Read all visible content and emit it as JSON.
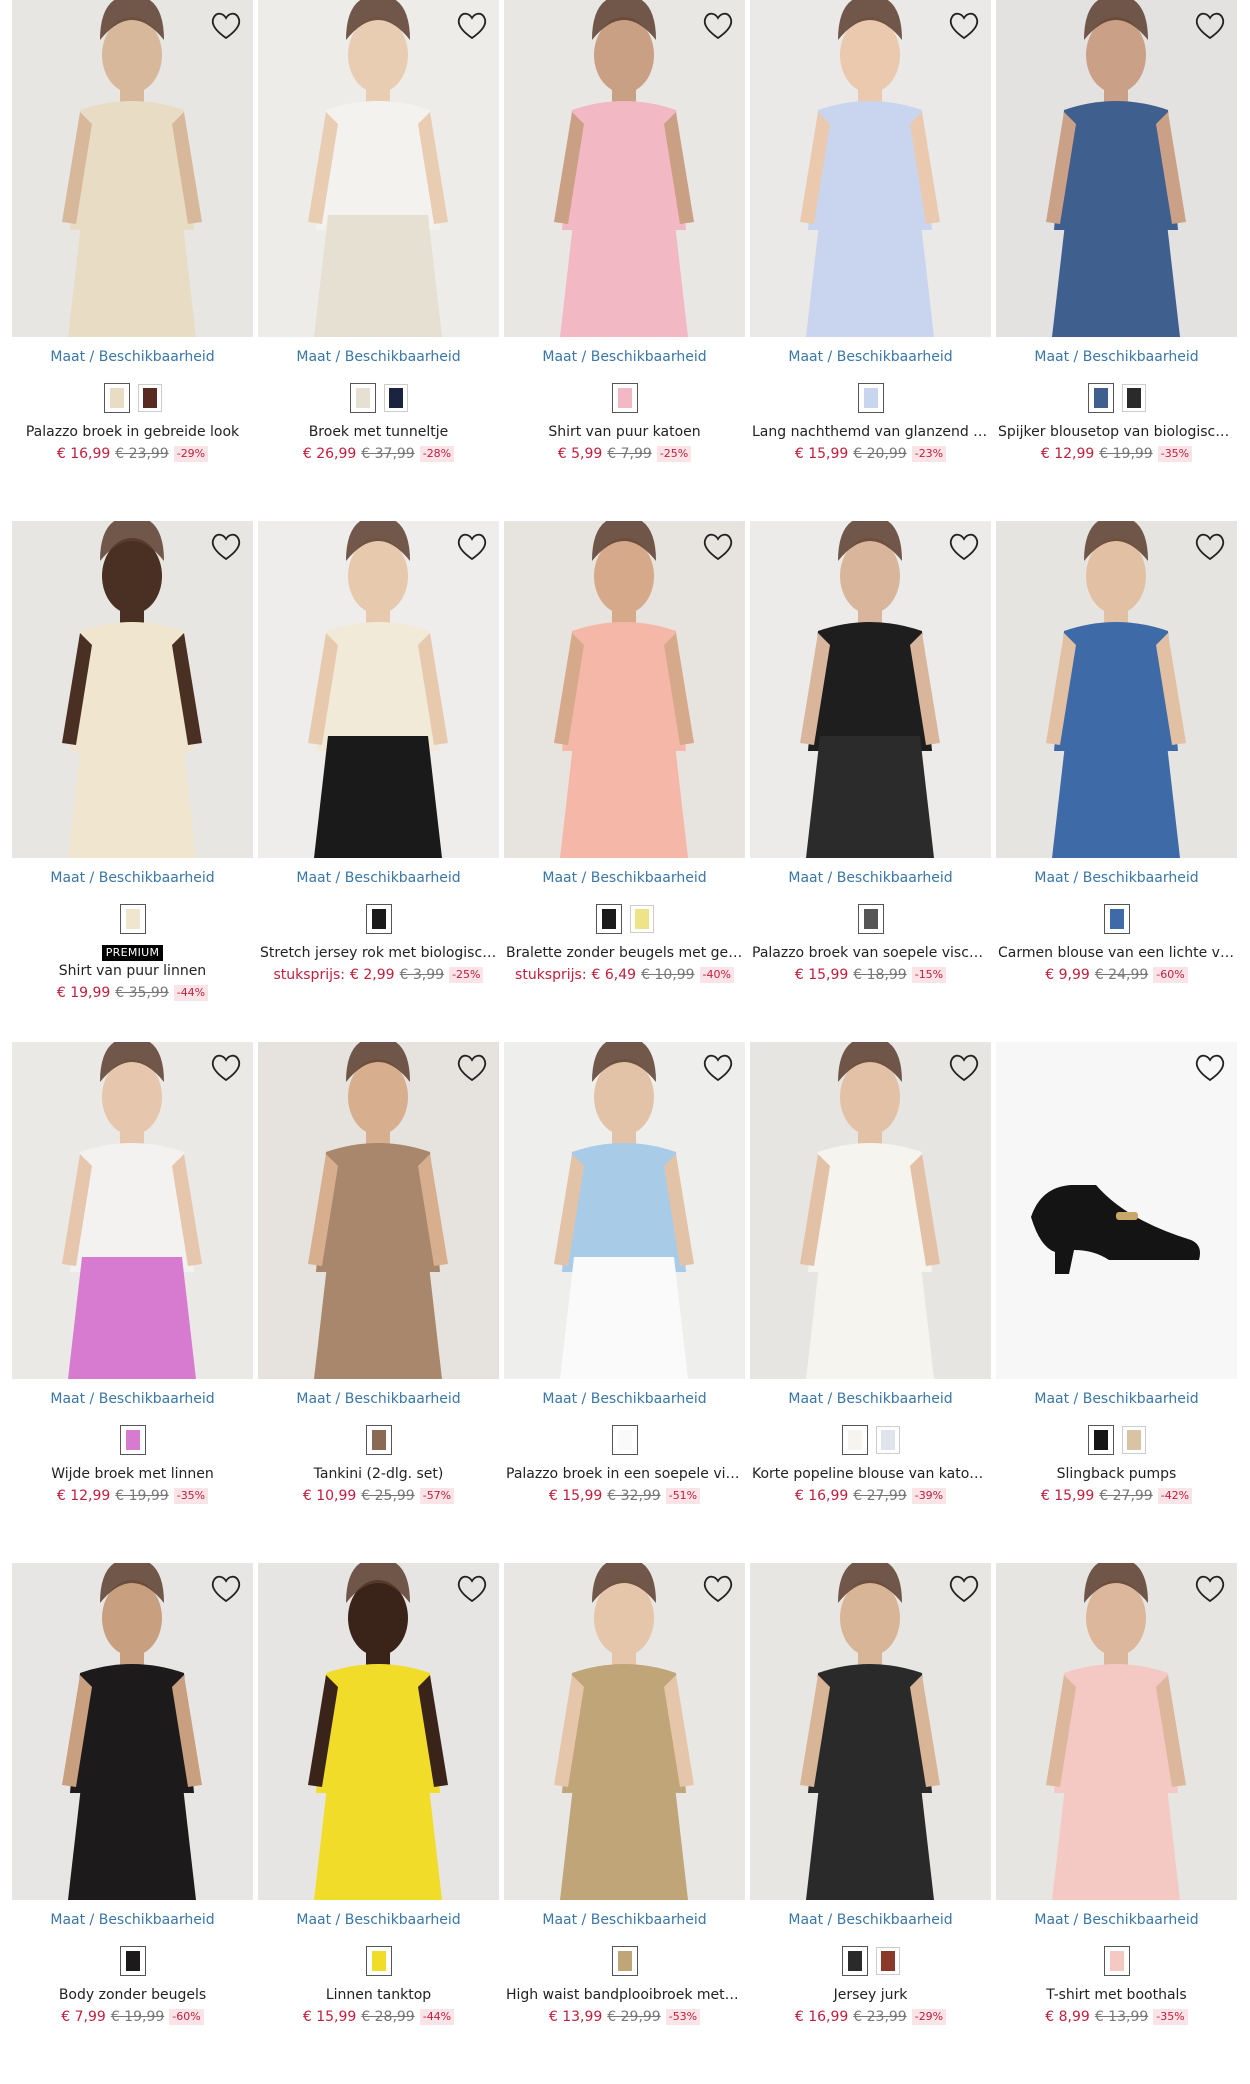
{
  "size_link_label": "Maat / Beschikbaarheid",
  "colors": {
    "price": "#c01e3c",
    "link": "#3a76a6"
  },
  "products": [
    {
      "name": "Palazzo broek in gebreide look",
      "price": "€ 16,99",
      "old": "€ 23,99",
      "discount": "-29%",
      "bg": "#e8e6e3",
      "garment": "#e8dcc4",
      "skin": "#d8b89a",
      "top": "#e8dcc4",
      "swatches": [
        "#e8dcc4",
        "#5a2a22"
      ]
    },
    {
      "name": "Broek met tunneltje",
      "price": "€ 26,99",
      "old": "€ 37,99",
      "discount": "-28%",
      "bg": "#eeece9",
      "garment": "#e6e0d2",
      "skin": "#e9cdb3",
      "top": "#f4f2ee",
      "swatches": [
        "#e6e0d2",
        "#1b2340"
      ]
    },
    {
      "name": "Shirt van puur katoen",
      "price": "€ 5,99",
      "old": "€ 7,99",
      "discount": "-25%",
      "bg": "#e9e7e4",
      "garment": "#f2b8c4",
      "skin": "#caa084",
      "top": "#f2b8c4",
      "swatches": [
        "#f2b8c4"
      ]
    },
    {
      "name": "Lang nachthemd van glanzend satijn",
      "price": "€ 15,99",
      "old": "€ 20,99",
      "discount": "-23%",
      "bg": "#ebe9e7",
      "garment": "#c9d4ee",
      "skin": "#eac9ae",
      "top": "#c9d4ee",
      "swatches": [
        "#c9d4ee"
      ]
    },
    {
      "name": "Spijker blousetop van biologisch ka…",
      "price": "€ 12,99",
      "old": "€ 19,99",
      "discount": "-35%",
      "bg": "#e4e2e0",
      "garment": "#3f5f8f",
      "skin": "#caa086",
      "top": "#3f5f8f",
      "swatches": [
        "#3f5f8f",
        "#2a2a2a"
      ]
    },
    {
      "name": "Shirt van puur linnen",
      "premium": "PREMIUM",
      "price": "€ 19,99",
      "old": "€ 35,99",
      "discount": "-44%",
      "bg": "#e8e6e3",
      "garment": "#f0e6cf",
      "skin": "#4a2f23",
      "top": "#f0e6cf",
      "swatches": [
        "#f0e6cf"
      ]
    },
    {
      "name": "Stretch jersey rok met biologisch k…",
      "unit": "stuksprijs:",
      "price": "€ 2,99",
      "old": "€ 3,99",
      "discount": "-25%",
      "bg": "#efedeb",
      "garment": "#1a1a1a",
      "skin": "#e7c9ae",
      "top": "#f2ead8",
      "swatches": [
        "#1a1a1a"
      ]
    },
    {
      "name": "Bralette zonder beugels met gevul…",
      "unit": "stuksprijs:",
      "price": "€ 6,49",
      "old": "€ 10,99",
      "discount": "-40%",
      "bg": "#e7e3df",
      "garment": "#f5b8a8",
      "skin": "#d6a98b",
      "top": "#f5b8a8",
      "swatches": [
        "#1a1a1a",
        "#efe38a"
      ]
    },
    {
      "name": "Palazzo broek van soepele viscose",
      "price": "€ 15,99",
      "old": "€ 18,99",
      "discount": "-15%",
      "bg": "#ecebe9",
      "garment": "#2b2b2b",
      "skin": "#d9b69b",
      "top": "#1e1e1e",
      "swatches": [
        "#555555"
      ]
    },
    {
      "name": "Carmen blouse van een lichte visco…",
      "price": "€ 9,99",
      "old": "€ 24,99",
      "discount": "-60%",
      "bg": "#e6e4e1",
      "garment": "#3e6aa8",
      "skin": "#e2c0a4",
      "top": "#3e6aa8",
      "swatches": [
        "#3e6aa8"
      ]
    },
    {
      "name": "Wijde broek met linnen",
      "price": "€ 12,99",
      "old": "€ 19,99",
      "discount": "-35%",
      "bg": "#ebe9e6",
      "garment": "#d77bd0",
      "skin": "#e6c6ac",
      "top": "#f4f2f0",
      "swatches": [
        "#d77bd0"
      ]
    },
    {
      "name": "Tankini (2-dlg. set)",
      "price": "€ 10,99",
      "old": "€ 25,99",
      "discount": "-57%",
      "bg": "#e6e3df",
      "garment": "#a9876c",
      "skin": "#d7ae8e",
      "top": "#a9876c",
      "swatches": [
        "#8a6a55"
      ]
    },
    {
      "name": "Palazzo broek in een soepele viscos…",
      "price": "€ 15,99",
      "old": "€ 32,99",
      "discount": "-51%",
      "bg": "#eeeeec",
      "garment": "#fafafa",
      "skin": "#e3c3a7",
      "top": "#a8cbe8",
      "swatches": [
        "#fafafa"
      ]
    },
    {
      "name": "Korte popeline blouse van katoen …",
      "price": "€ 16,99",
      "old": "€ 27,99",
      "discount": "-39%",
      "bg": "#e7e5e2",
      "garment": "#f6f4ef",
      "skin": "#e3c1a6",
      "top": "#f6f4ef",
      "swatches": [
        "#f6f4ef",
        "#e0e4ea"
      ]
    },
    {
      "name": "Slingback pumps",
      "price": "€ 15,99",
      "old": "€ 27,99",
      "discount": "-42%",
      "bg": "#f7f7f7",
      "garment": "#141414",
      "skin": "#f7f7f7",
      "top": "#141414",
      "swatches": [
        "#141414",
        "#d9c3a2"
      ]
    },
    {
      "name": "Body zonder beugels",
      "price": "€ 7,99",
      "old": "€ 19,99",
      "discount": "-60%",
      "bg": "#e8e6e4",
      "garment": "#1c1a1a",
      "skin": "#c9a07f",
      "top": "#1c1a1a",
      "swatches": [
        "#1c1a1a"
      ]
    },
    {
      "name": "Linnen tanktop",
      "price": "€ 15,99",
      "old": "€ 28,99",
      "discount": "-44%",
      "bg": "#e7e5e3",
      "garment": "#f2dc2a",
      "skin": "#3a2419",
      "top": "#f2dc2a",
      "swatches": [
        "#f2dc2a"
      ]
    },
    {
      "name": "High waist bandplooibroek met linn…",
      "price": "€ 13,99",
      "old": "€ 29,99",
      "discount": "-53%",
      "bg": "#e9e7e4",
      "garment": "#bfa578",
      "skin": "#e6c6aa",
      "top": "#bfa578",
      "swatches": [
        "#bfa578"
      ]
    },
    {
      "name": "Jersey jurk",
      "price": "€ 16,99",
      "old": "€ 23,99",
      "discount": "-29%",
      "bg": "#e8e6e3",
      "garment": "#2a2a2a",
      "skin": "#d9b597",
      "top": "#2a2a2a",
      "swatches": [
        "#2a2a2a",
        "#8a3a2a"
      ]
    },
    {
      "name": "T-shirt met boothals",
      "price": "€ 8,99",
      "old": "€ 13,99",
      "discount": "-35%",
      "bg": "#e7e5e2",
      "garment": "#f4c9c4",
      "skin": "#dcb79b",
      "top": "#f4c9c4",
      "swatches": [
        "#f4c9c4"
      ]
    }
  ]
}
